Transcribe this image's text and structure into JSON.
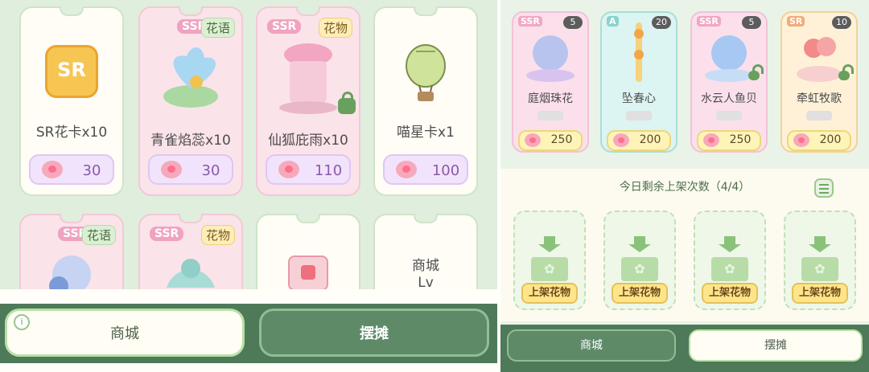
{
  "shop": {
    "cards": [
      {
        "title": "SR花卡x10",
        "price": "30",
        "badge": "",
        "tag": ""
      },
      {
        "title": "青雀焰蕊x10",
        "price": "30",
        "badge": "SSR",
        "tag": "花语"
      },
      {
        "title": "仙狐庇雨x10",
        "price": "110",
        "badge": "SSR",
        "tag": "花物"
      },
      {
        "title": "喵星卡x1",
        "price": "100",
        "badge": "",
        "tag": ""
      }
    ],
    "row2": [
      {
        "badge": "SSR",
        "tag": "花语"
      },
      {
        "badge": "SSR",
        "tag": "花物"
      },
      {
        "title": ""
      },
      {
        "title": "商城",
        "subtitle": "Lv"
      }
    ],
    "sr_icon_text": "SR"
  },
  "left_tabs": {
    "shop": "商城",
    "stall": "摆摊",
    "info": "i"
  },
  "stall": {
    "items": [
      {
        "rarity": "SSR",
        "qty": "5",
        "name": "庭烟珠花",
        "price": "250"
      },
      {
        "rarity": "A",
        "qty": "20",
        "name": "坠春心",
        "price": "200"
      },
      {
        "rarity": "SSR",
        "qty": "5",
        "name": "水云人鱼贝",
        "price": "250"
      },
      {
        "rarity": "SR",
        "qty": "10",
        "name": "牵虹牧歌",
        "price": "200"
      }
    ],
    "remaining_title": "今日剩余上架次数（4/4）",
    "shelf_label": "上架花物"
  },
  "right_tabs": {
    "shop": "商城",
    "stall": "摆摊"
  },
  "colors": {
    "accent_green": "#4f7a59",
    "pink": "#fbe3ea",
    "gold": "#ffe58a"
  }
}
